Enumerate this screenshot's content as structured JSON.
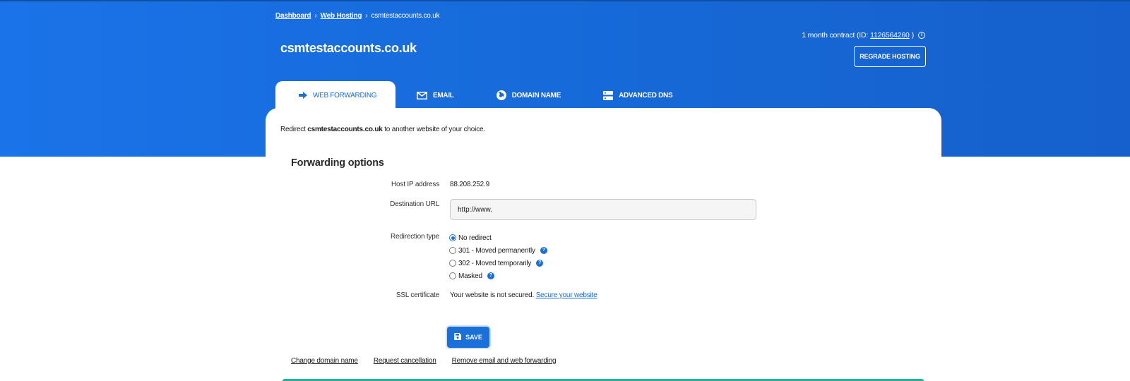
{
  "breadcrumb": {
    "items": [
      "Dashboard",
      "Web Hosting",
      "csmtestaccounts.co.uk"
    ],
    "separator": "›"
  },
  "header": {
    "title": "csmtestaccounts.co.uk",
    "contract_prefix": "1 month contract (ID: ",
    "contract_id": "1126564260",
    "contract_suffix": ")",
    "regrade_label": "REGRADE HOSTING"
  },
  "tabs": [
    {
      "label": "WEB FORWARDING",
      "icon": "arrow-right-icon",
      "active": true
    },
    {
      "label": "EMAIL",
      "icon": "envelope-icon",
      "active": false
    },
    {
      "label": "DOMAIN NAME",
      "icon": "globe-icon",
      "active": false
    },
    {
      "label": "ADVANCED DNS",
      "icon": "server-icon",
      "active": false
    }
  ],
  "intro": {
    "prefix": "Redirect ",
    "domain": "csmtestaccounts.co.uk",
    "suffix": " to another website of your choice."
  },
  "forwarding": {
    "title": "Forwarding options",
    "host_ip_label": "Host IP address",
    "host_ip_value": "88.208.252.9",
    "destination_label": "Destination URL",
    "destination_value": "http://www.",
    "redirection_label": "Redirection type",
    "options": [
      {
        "label": "No redirect",
        "checked": true,
        "help": false
      },
      {
        "label": "301 - Moved permanently",
        "checked": false,
        "help": true
      },
      {
        "label": "302 - Moved temporarily",
        "checked": false,
        "help": true
      },
      {
        "label": "Masked",
        "checked": false,
        "help": true
      }
    ],
    "ssl_label": "SSL certificate",
    "ssl_status": "Your website is not secured. ",
    "ssl_link": "Secure your website"
  },
  "actions": {
    "save_label": "SAVE"
  },
  "footer_links": [
    "Change domain name",
    "Request cancellation",
    "Remove email and web forwarding"
  ],
  "colors": {
    "brand_blue": "#1a6fd8",
    "accent_green": "#23b59a"
  }
}
